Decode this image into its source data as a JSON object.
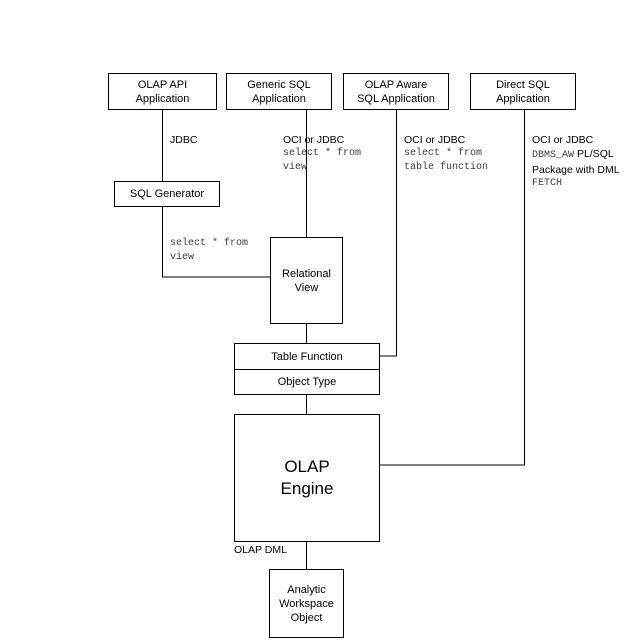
{
  "diagram": {
    "title": "OLAP architecture data flow diagram",
    "background_color": "#ffffff",
    "line_color": "#000000",
    "text_color": "#000000",
    "mono_text_color": "#3b3b3b"
  },
  "nodes": {
    "olap_api_application": {
      "line1": "OLAP API",
      "line2": "Application"
    },
    "generic_sql_application": {
      "line1": "Generic SQL",
      "line2": "Application"
    },
    "olap_aware_sql_application": {
      "line1": "OLAP Aware",
      "line2": "SQL Application"
    },
    "direct_sql_application": {
      "line1": "Direct SQL",
      "line2": "Application"
    },
    "sql_generator": {
      "line1": "SQL Generator"
    },
    "relational_view": {
      "line1": "Relational",
      "line2": "View"
    },
    "table_function": {
      "line1": "Table Function"
    },
    "object_type": {
      "line1": "Object Type"
    },
    "olap_engine": {
      "line1": "OLAP",
      "line2": "Engine"
    },
    "analytic_workspace_object": {
      "line1": "Analytic",
      "line2": "Workspace",
      "line3": "Object"
    }
  },
  "edge_labels": {
    "olap_api_protocol": "JDBC",
    "sql_generator_query_line1": "select * from",
    "sql_generator_query_line2": "view",
    "generic_sql_protocol": "OCI or JDBC",
    "generic_sql_query_line1": "select * from",
    "generic_sql_query_line2": "view",
    "olap_aware_protocol": "OCI or JDBC",
    "olap_aware_query_line1": "select * from",
    "olap_aware_query_line2": "table function",
    "direct_sql_protocol": "OCI or JDBC",
    "direct_sql_package_mono": "DBMS_AW",
    "direct_sql_package_sans": "PL/SQL",
    "direct_sql_package_line2": "Package with DML",
    "direct_sql_fetch": "FETCH",
    "olap_engine_to_workspace": "OLAP DML"
  }
}
